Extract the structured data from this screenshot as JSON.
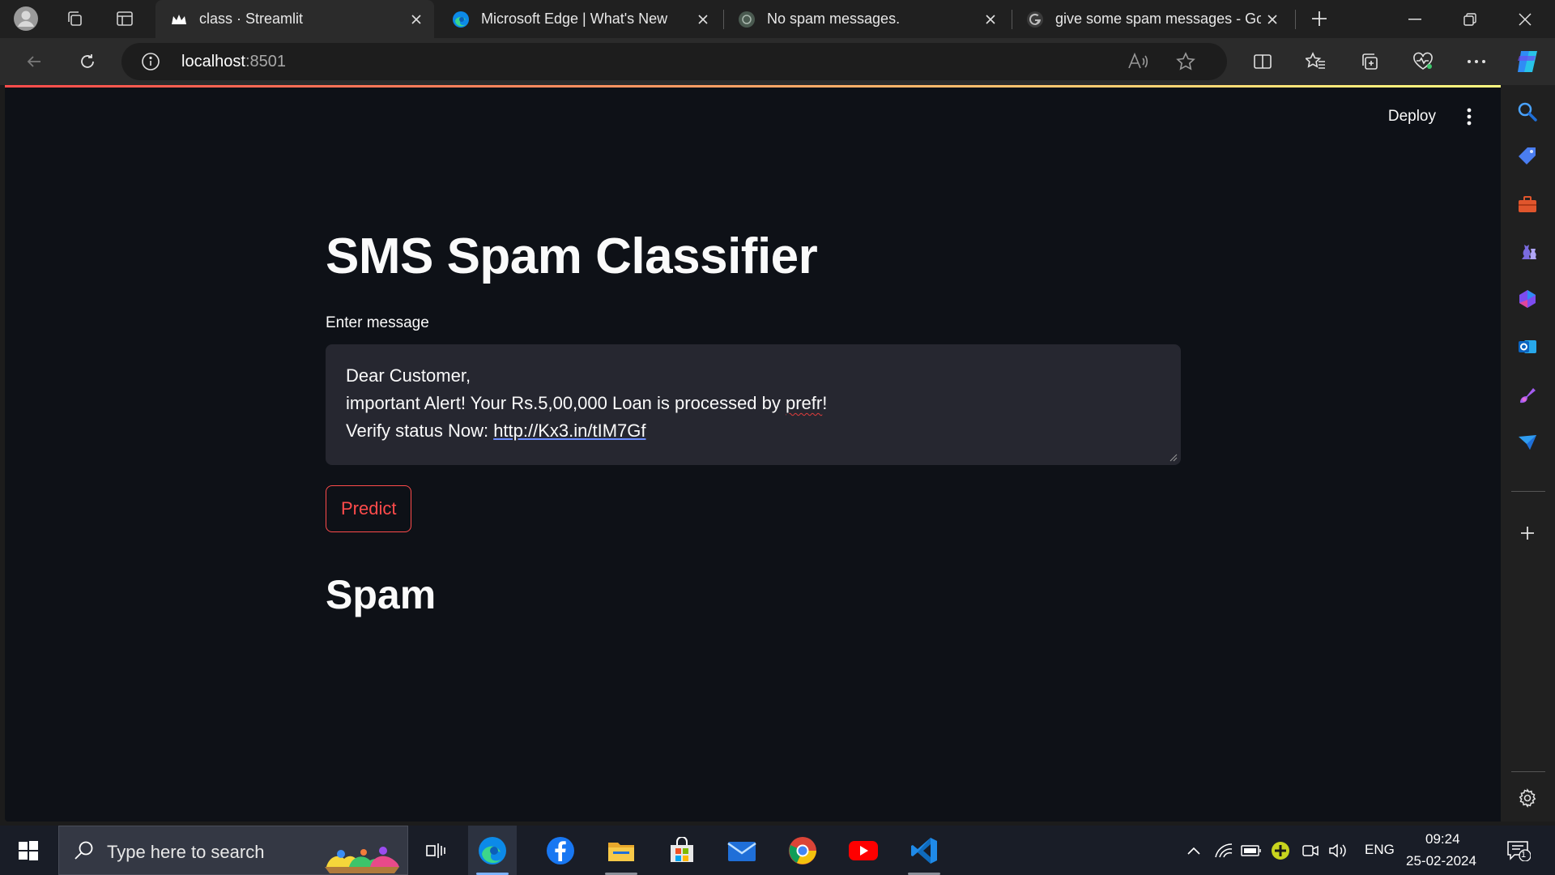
{
  "browser": {
    "tabs": [
      {
        "title": "class · Streamlit",
        "active": true
      },
      {
        "title": "Microsoft Edge | What's New",
        "active": false
      },
      {
        "title": "No spam messages.",
        "active": false
      },
      {
        "title": "give some spam messages - Google",
        "active": false
      }
    ],
    "address": {
      "host": "localhost",
      "port": ":8501"
    }
  },
  "app": {
    "deploy_label": "Deploy",
    "title": "SMS Spam Classifier",
    "input_label": "Enter message",
    "message_lines": {
      "line1": "Dear Customer,",
      "line2_pre": "important Alert! Your Rs.5,00,000 Loan is processed by ",
      "line2_word": "prefr",
      "line2_post": "!",
      "line3_pre": "Verify status Now: ",
      "line3_link": "http://Kx3.in/tIM7Gf"
    },
    "predict_label": "Predict",
    "result": "Spam"
  },
  "taskbar": {
    "search_placeholder": "Type here to search",
    "language": "ENG",
    "time": "09:24",
    "date": "25-02-2024",
    "notification_count": "1"
  },
  "colors": {
    "accent": "#ff4b4b",
    "app_bg": "#0e1117",
    "input_bg": "#262730"
  }
}
